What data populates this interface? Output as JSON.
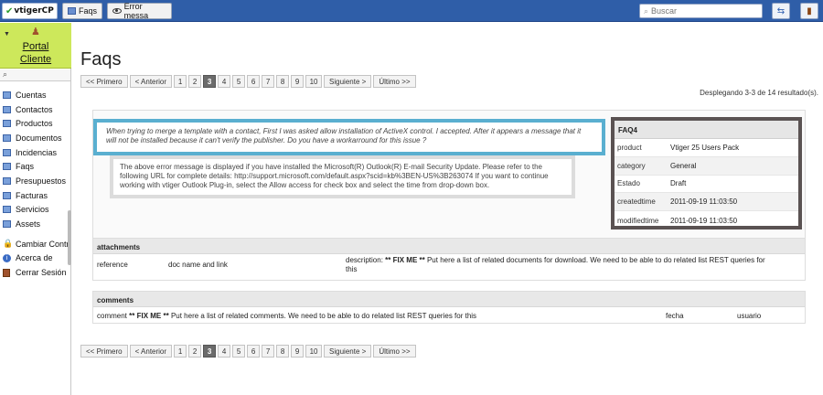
{
  "topbar": {
    "logo_text": "vtigerCP",
    "tabs": [
      {
        "label": "Faqs"
      },
      {
        "label": "Error messa"
      }
    ],
    "search_placeholder": "Buscar"
  },
  "sidebar": {
    "portal_label_line1": "Portal",
    "portal_label_line2": "Cliente",
    "items": [
      {
        "label": "Cuentas"
      },
      {
        "label": "Contactos"
      },
      {
        "label": "Productos"
      },
      {
        "label": "Documentos"
      },
      {
        "label": "Incidencias"
      },
      {
        "label": "Faqs"
      },
      {
        "label": "Presupuestos"
      },
      {
        "label": "Facturas"
      },
      {
        "label": "Servicios"
      },
      {
        "label": "Assets"
      }
    ],
    "actions": [
      {
        "label": "Cambiar Contraseña"
      },
      {
        "label": "Acerca de"
      },
      {
        "label": "Cerrar Sesión"
      }
    ]
  },
  "main": {
    "title": "Faqs",
    "pager": {
      "first": "<< Primero",
      "prev": "< Anterior",
      "pages": [
        "1",
        "2",
        "3",
        "4",
        "5",
        "6",
        "7",
        "8",
        "9",
        "10"
      ],
      "active_page": "3",
      "next": "Siguiente >",
      "last": "Último >>"
    },
    "results_text": "Desplegando 3-3 de 14 resultado(s).",
    "question": "When trying to merge a template with a contact, First I was asked allow installation of ActiveX control. I accepted. After it appears a message that it will not be installed because it can't verify the publisher. Do you have a workarround for this issue ?",
    "answer": "The above error message is displayed if you have installed the Microsoft(R) Outlook(R) E-mail Security Update. Please refer to the following URL for complete details: http://support.microsoft.com/default.aspx?scid=kb%3BEN-US%3B263074 If you want to continue working with vtiger Outlook Plug-in, select the Allow access for check box and select the time from drop-down box.",
    "faq_card": {
      "id": "FAQ4",
      "rows": [
        {
          "key": "product",
          "value": "Vtiger 25 Users Pack"
        },
        {
          "key": "category",
          "value": "General"
        },
        {
          "key": "Estado",
          "value": "Draft"
        },
        {
          "key": "createdtime",
          "value": "2011-09-19 11:03:50"
        },
        {
          "key": "modifiedtime",
          "value": "2011-09-19 11:03:50"
        }
      ]
    },
    "attachments": {
      "title": "attachments",
      "reference": "reference",
      "doc": "doc name and link",
      "desc_prefix": "description:",
      "fixme": "** FIX ME **",
      "desc_text": "Put here a list of related documents for download. We need to be able to do related list REST queries for",
      "desc_line2": "this"
    },
    "comments": {
      "title": "comments",
      "prefix": "comment",
      "fixme": "** FIX ME **",
      "text": "Put here a list of related comments. We need to be able to do related list REST queries for this",
      "fecha": "fecha",
      "usuario": "usuario"
    }
  }
}
